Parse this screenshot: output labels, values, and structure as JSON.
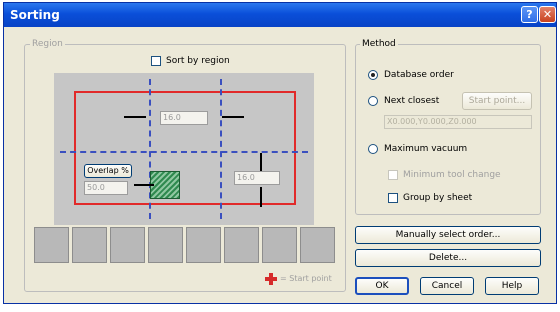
{
  "window": {
    "title": "Sorting"
  },
  "region": {
    "legend": "Region",
    "sort_by_region_label": "Sort by region",
    "sort_by_region_checked": false,
    "horizontal_gap": "16.0",
    "vertical_gap": "16.0",
    "overlap_label": "Overlap %",
    "overlap_value": "50.0",
    "start_point_label": "= Start point",
    "tile_count": 8
  },
  "method": {
    "legend": "Method",
    "options": {
      "database_order": "Database order",
      "next_closest": "Next closest",
      "maximum_vacuum": "Maximum vacuum"
    },
    "selected": "database_order",
    "start_point_button": "Start point...",
    "coordinates": "X0.000,Y0.000,Z0.000",
    "minimum_tool_change": "Minimum tool change",
    "group_by_sheet": "Group by sheet"
  },
  "buttons": {
    "manual_order": "Manually select order...",
    "delete": "Delete...",
    "ok": "OK",
    "cancel": "Cancel",
    "help": "Help"
  },
  "titlebar_buttons": {
    "help": "?",
    "close": "✕"
  },
  "colors": {
    "region_outline": "#e12a2a",
    "dash_lines": "#3a4fbf",
    "hatch": "#2f8a4f",
    "start_cross": "#d62b2b"
  }
}
